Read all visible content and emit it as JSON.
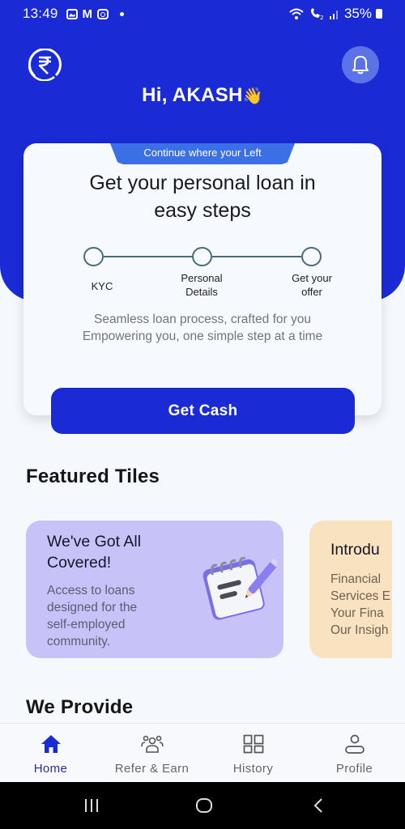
{
  "status_bar": {
    "time": "13:49",
    "left_icons": [
      "gallery-icon",
      "gmail-icon",
      "instagram-icon",
      "notification-dot-icon"
    ],
    "right_icons": [
      "wifi-icon",
      "volte-call-icon",
      "signal-icon"
    ],
    "battery": "35%"
  },
  "header": {
    "logo_icon": "rupee-logo-icon",
    "notification_icon": "bell-icon",
    "greeting": "Hi, AKASH",
    "greeting_emoji": "👋",
    "brand_color": "#1a2bd6"
  },
  "loan_card": {
    "banner": "Continue where your Left",
    "title_line1": "Get your personal loan in",
    "title_line2": "easy steps",
    "steps": [
      {
        "label_line1": "KYC",
        "label_line2": ""
      },
      {
        "label_line1": "Personal",
        "label_line2": "Details"
      },
      {
        "label_line1": "Get your",
        "label_line2": "offer"
      }
    ],
    "desc_line1": "Seamless loan process, crafted for you",
    "desc_line2": "Empowering you, one simple step at a time",
    "cta": "Get Cash"
  },
  "featured": {
    "title": "Featured Tiles",
    "tiles": [
      {
        "title_line1": "We've Got All",
        "title_line2": "Covered!",
        "desc_lines": [
          "Access to loans",
          "designed for the",
          "self-employed",
          "community."
        ],
        "icon": "notepad-icon",
        "bg": "#c7c3f8"
      },
      {
        "title_line1": "Introdu",
        "desc_lines": [
          "Financial",
          "Services E",
          "Your Fina",
          "Our Insigh"
        ],
        "bg": "#f8e2bf"
      }
    ]
  },
  "we_provide": {
    "title": "We Provide"
  },
  "bottom_nav": {
    "items": [
      {
        "label": "Home",
        "icon": "home-icon",
        "active": true
      },
      {
        "label": "Refer & Earn",
        "icon": "users-icon",
        "active": false
      },
      {
        "label": "History",
        "icon": "grid-icon",
        "active": false
      },
      {
        "label": "Profile",
        "icon": "user-icon",
        "active": false
      }
    ],
    "active_color": "#1a2bd6"
  },
  "android_nav": [
    "recents-icon",
    "home-circle-icon",
    "back-icon"
  ]
}
